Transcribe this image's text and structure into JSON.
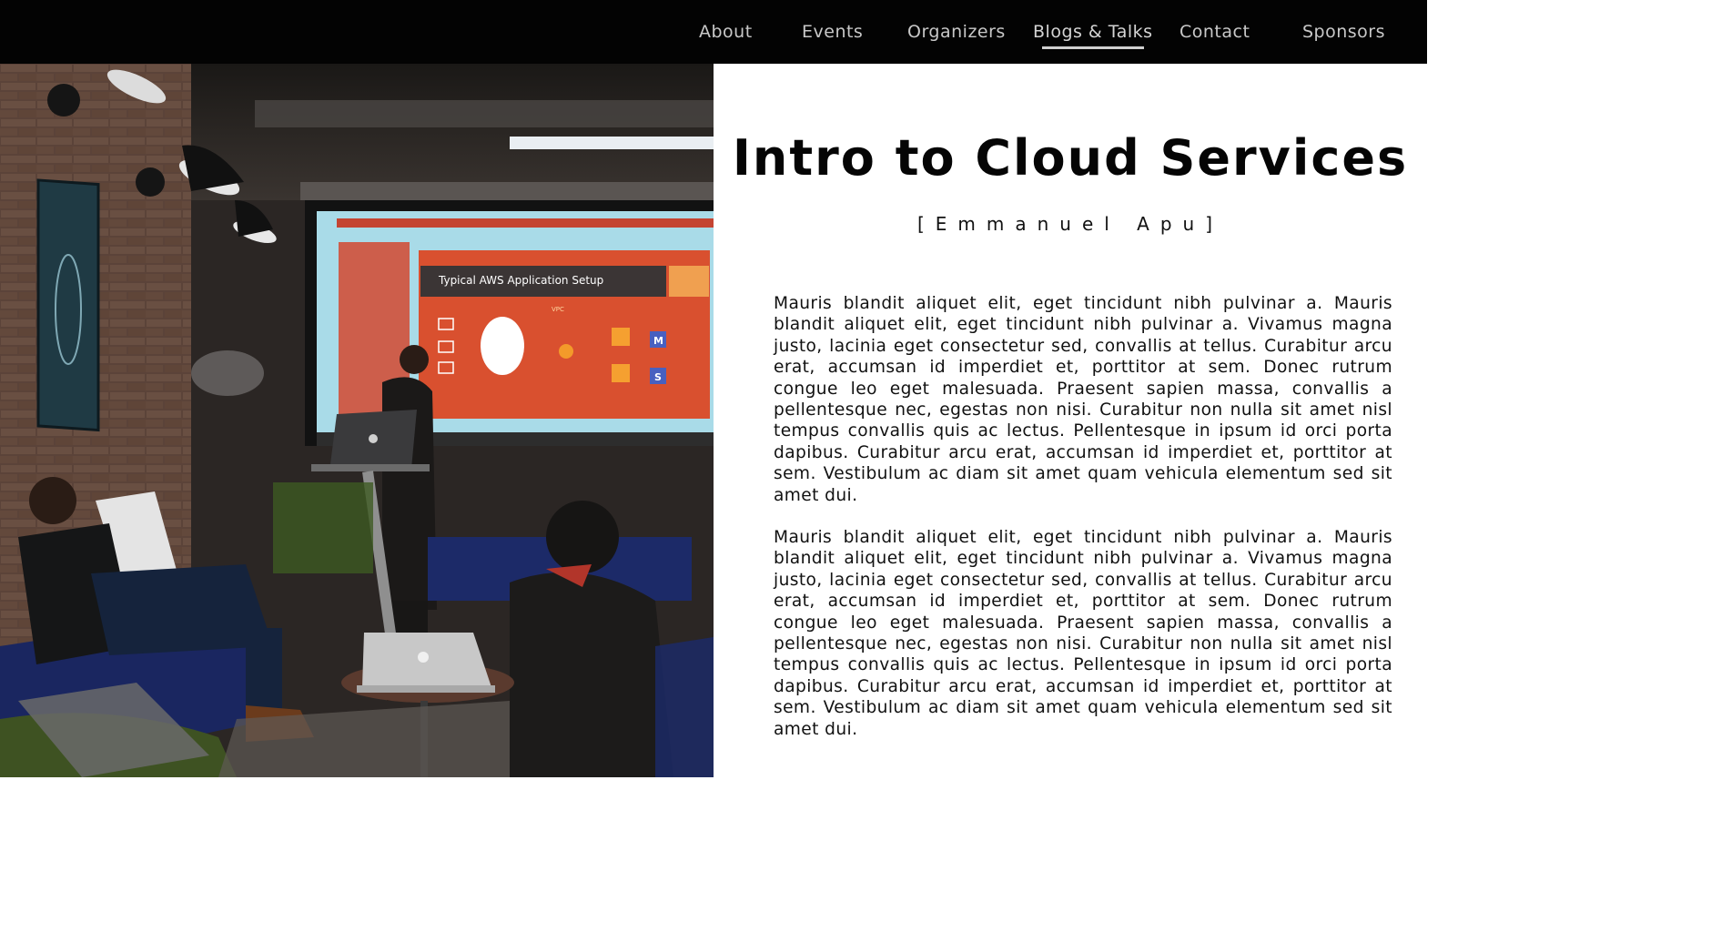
{
  "nav": {
    "items": [
      {
        "label": "About"
      },
      {
        "label": "Events"
      },
      {
        "label": "Organizers"
      },
      {
        "label": "Blogs & Talks",
        "active": true
      },
      {
        "label": "Contact"
      },
      {
        "label": "Sponsors"
      }
    ]
  },
  "photo": {
    "slide_title": "Typical AWS Application Setup",
    "slide_tag": "VPC",
    "slide_icon_m": "M",
    "slide_icon_s": "S"
  },
  "article": {
    "title": "Intro to Cloud Services",
    "speaker": "[Emmanuel Apu]",
    "paragraphs": [
      "Mauris blandit aliquet elit, eget tincidunt nibh pulvinar a. Mauris blandit aliquet elit, eget tincidunt nibh pulvinar a. Vivamus magna justo, lacinia eget consectetur sed, convallis at tellus. Curabitur arcu erat, accumsan id imperdiet et, porttitor at sem. Donec rutrum congue leo eget malesuada. Praesent sapien massa, convallis a pellentesque nec, egestas non nisi. Curabitur non nulla sit amet nisl tempus convallis quis ac lectus. Pellentesque in ipsum id orci porta dapibus. Curabitur arcu erat, accumsan id imperdiet et, porttitor at sem. Vestibulum ac diam sit amet quam vehicula elementum sed sit amet dui.",
      "Mauris blandit aliquet elit, eget tincidunt nibh pulvinar a. Mauris blandit aliquet elit, eget tincidunt nibh pulvinar a. Vivamus magna justo, lacinia eget consectetur sed, convallis at tellus. Curabitur arcu erat, accumsan id imperdiet et, porttitor at sem. Donec rutrum congue leo eget malesuada. Praesent sapien massa, convallis a pellentesque nec, egestas non nisi. Curabitur non nulla sit amet nisl tempus convallis quis ac lectus. Pellentesque in ipsum id orci porta dapibus. Curabitur arcu erat, accumsan id imperdiet et, porttitor at sem. Vestibulum ac diam sit amet quam vehicula elementum sed sit amet dui."
    ]
  },
  "colors": {
    "nav_bg": "#030303",
    "nav_text": "#c8c8c8",
    "slide_bg": "#d9502f",
    "text": "#111111"
  }
}
